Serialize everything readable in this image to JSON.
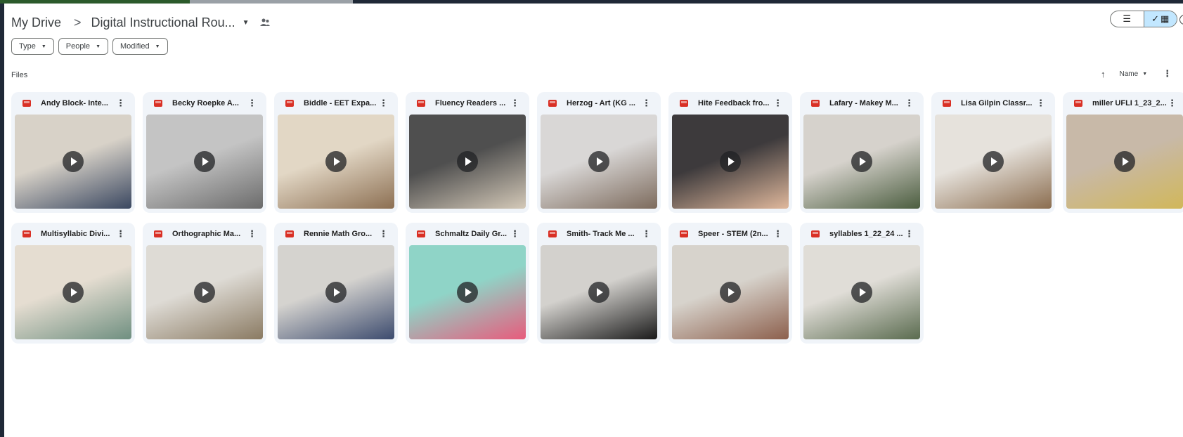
{
  "breadcrumb": {
    "root": "My Drive",
    "separator": ">",
    "current": "Digital Instructional Rou..."
  },
  "view_toggle": {
    "list_icon": "list-icon",
    "grid_icon": "grid-icon",
    "active": "grid"
  },
  "filters": [
    {
      "label": "Type"
    },
    {
      "label": "People"
    },
    {
      "label": "Modified"
    }
  ],
  "section_label": "Files",
  "sort": {
    "label": "Name",
    "direction": "up-arrow-icon"
  },
  "files": [
    {
      "name": "Andy Block- Inte...",
      "thumb": [
        "#d8d2c8",
        "#3a4760"
      ]
    },
    {
      "name": "Becky Roepke A...",
      "thumb": [
        "#c4c4c4",
        "#6b6b6b"
      ]
    },
    {
      "name": "Biddle - EET Expa...",
      "thumb": [
        "#e2d7c5",
        "#8c6f52"
      ]
    },
    {
      "name": "Fluency Readers ...",
      "thumb": [
        "#4f4f4f",
        "#d4c9b8"
      ]
    },
    {
      "name": "Herzog - Art (KG ...",
      "thumb": [
        "#d9d7d6",
        "#7c6a5c"
      ]
    },
    {
      "name": "Hite Feedback fro...",
      "thumb": [
        "#3d3a3c",
        "#e0b89c"
      ]
    },
    {
      "name": "Lafary - Makey M...",
      "thumb": [
        "#d6d2cc",
        "#4b5d3f"
      ]
    },
    {
      "name": "Lisa Gilpin Classr...",
      "thumb": [
        "#e6e2dc",
        "#8b6d4f"
      ]
    },
    {
      "name": "miller UFLI 1_23_2...",
      "thumb": [
        "#c8b9a8",
        "#d1b75a"
      ]
    },
    {
      "name": "Multisyllabic Divi...",
      "thumb": [
        "#e5ddd1",
        "#6f8f80"
      ]
    },
    {
      "name": "Orthographic Ma...",
      "thumb": [
        "#dedbd5",
        "#8a7a62"
      ]
    },
    {
      "name": "Rennie Math Gro...",
      "thumb": [
        "#d5d3cf",
        "#3c4b6e"
      ]
    },
    {
      "name": "Schmaltz Daily Gr...",
      "thumb": [
        "#8fd4c7",
        "#e85b7c"
      ]
    },
    {
      "name": "Smith- Track Me ...",
      "thumb": [
        "#d3d1cd",
        "#1a1a1a"
      ]
    },
    {
      "name": "Speer - STEM (2n...",
      "thumb": [
        "#d7d3cc",
        "#8c5f4c"
      ]
    },
    {
      "name": "syllables 1_22_24 ...",
      "thumb": [
        "#e0ddd7",
        "#5a6b4f"
      ]
    }
  ]
}
